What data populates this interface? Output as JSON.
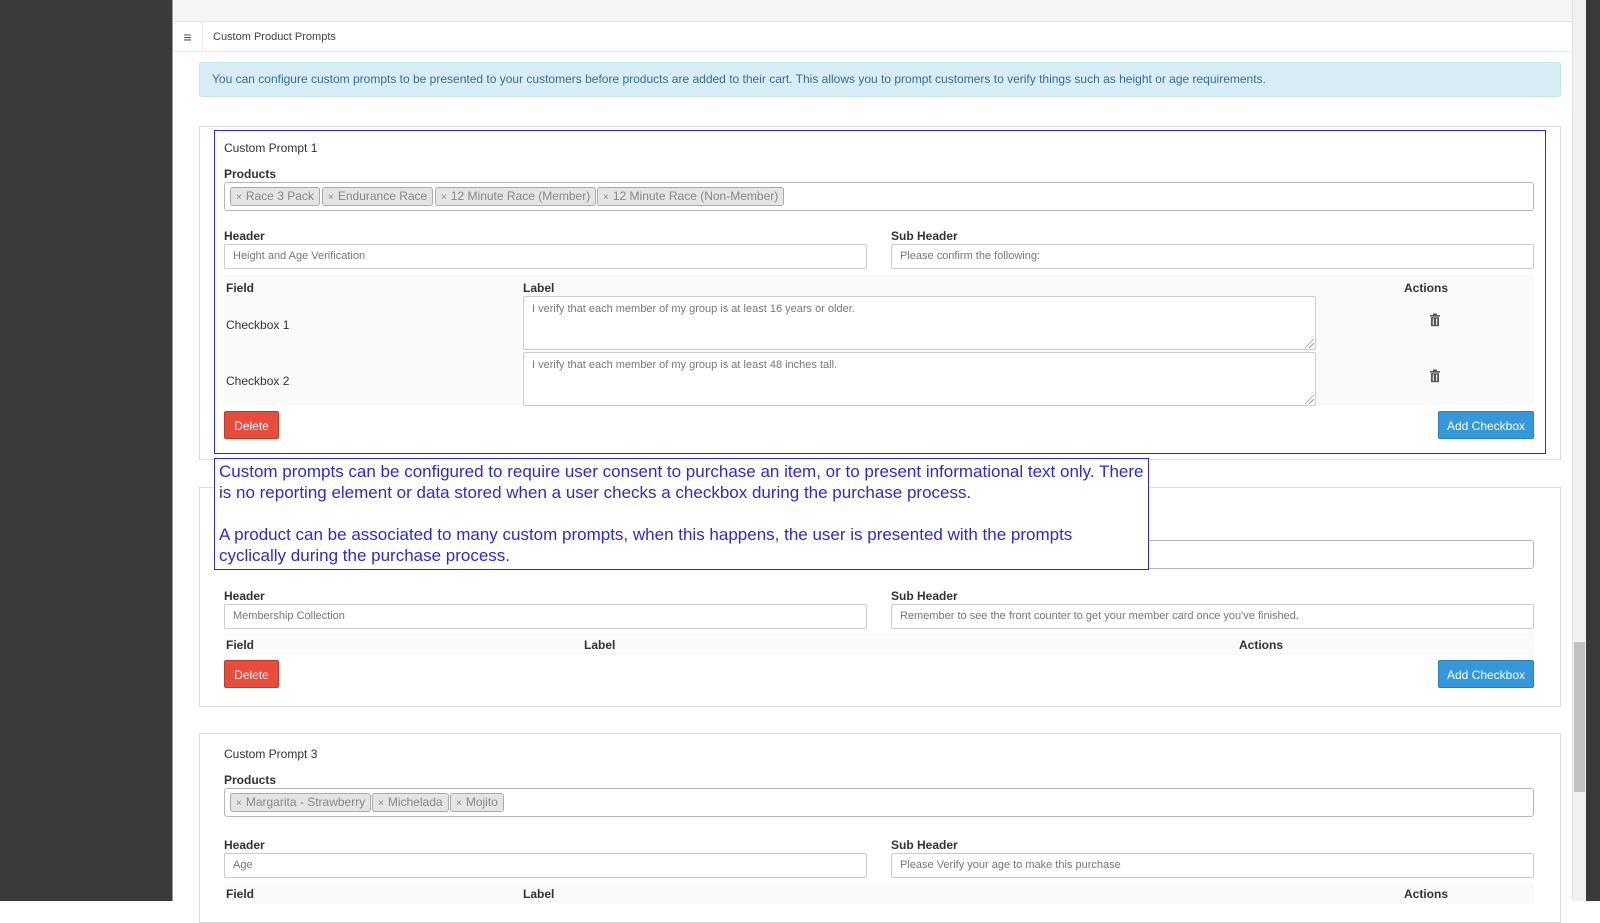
{
  "breadcrumb": {
    "title": "Custom Product Prompts"
  },
  "info_alert": {
    "text": "You can configure custom prompts to be presented to your customers before products are added to their cart. This allows you to prompt customers to verify things such as height or age requirements."
  },
  "labels": {
    "products": "Products",
    "header": "Header",
    "sub_header": "Sub Header",
    "field": "Field",
    "label": "Label",
    "actions": "Actions",
    "delete": "Delete",
    "add_checkbox": "Add Checkbox"
  },
  "prompts": [
    {
      "title": "Custom Prompt 1",
      "products": [
        "Race 3 Pack",
        "Endurance Race",
        "12 Minute Race (Member)",
        "12 Minute Race (Non-Member)"
      ],
      "header": "Height and Age Verification",
      "sub_header": "Please confirm the following:",
      "checkboxes": [
        {
          "field": "Checkbox 1",
          "label": "I verify that each member of my group is at least 16 years or older."
        },
        {
          "field": "Checkbox 2",
          "label": "I verify that each member of my group is at least 48 inches tall."
        }
      ]
    },
    {
      "title": "",
      "products": [],
      "header": "Membership Collection",
      "sub_header": "Remember to see the front counter to get your member card once you've finished.",
      "checkboxes": []
    },
    {
      "title": "Custom Prompt 3",
      "products": [
        "Margarita - Strawberry",
        "Michelada",
        "Mojito"
      ],
      "header": "Age",
      "sub_header": "Please Verify your age to make this purchase",
      "checkboxes": []
    }
  ],
  "callout": {
    "paragraph1": "Custom prompts can be configured to require user consent to purchase an item, or to present informational text only. There is no reporting element or data stored when a user checks a checkbox during the purchase process.",
    "paragraph2": "A product can be associated to many custom prompts, when this happens, the user is presented with the prompts cyclically during the purchase process."
  },
  "colors": {
    "delete": "#e74c3c",
    "add": "#3498db",
    "callout": "#2b2bd6",
    "info_bg": "#d9edf7"
  },
  "icons": {
    "menu": "hamburger-icon",
    "remove_tag": "close-icon",
    "delete_row": "trash-icon"
  }
}
